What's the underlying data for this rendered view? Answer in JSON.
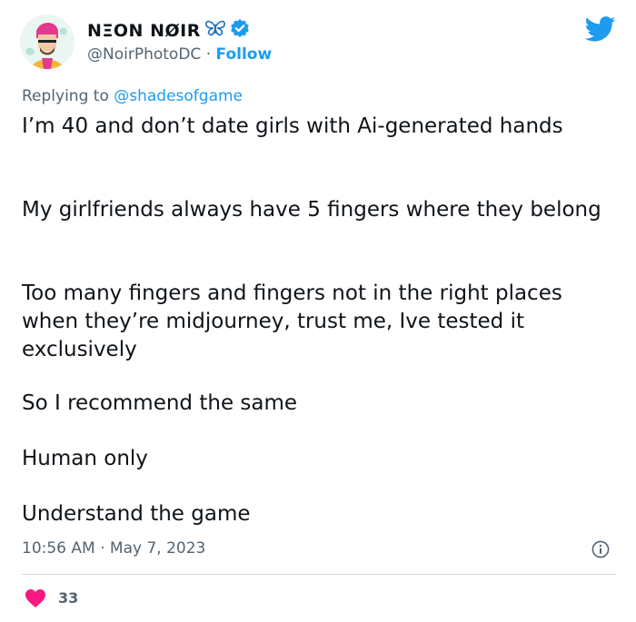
{
  "author": {
    "display_name": "NΞON NØIR",
    "handle": "@NoirPhotoDC",
    "separator": "·",
    "follow_label": "Follow"
  },
  "reply": {
    "prefix": "Replying to",
    "mention": "@shadesofgame"
  },
  "body": {
    "paragraphs": [
      "I’m 40 and don’t date girls with Ai-generated hands",
      "My girlfriends always have 5 fingers where they belong",
      "Too many fingers and fingers not in the right places when they’re midjourney, trust me, Ive tested it exclusively",
      "So I recommend the same",
      "Human only",
      "Understand the game"
    ]
  },
  "meta": {
    "time": "10:56 AM",
    "separator": "·",
    "date": "May 7, 2023"
  },
  "engagement": {
    "likes": "33"
  },
  "colors": {
    "accent": "#1d9bf0",
    "heart": "#f91880",
    "secondary_text": "#536471",
    "divider": "#cfd9de"
  },
  "icons": [
    "avatar",
    "butterfly-emoji-icon",
    "verified-badge-icon",
    "twitter-bird-icon",
    "info-icon",
    "heart-icon"
  ]
}
